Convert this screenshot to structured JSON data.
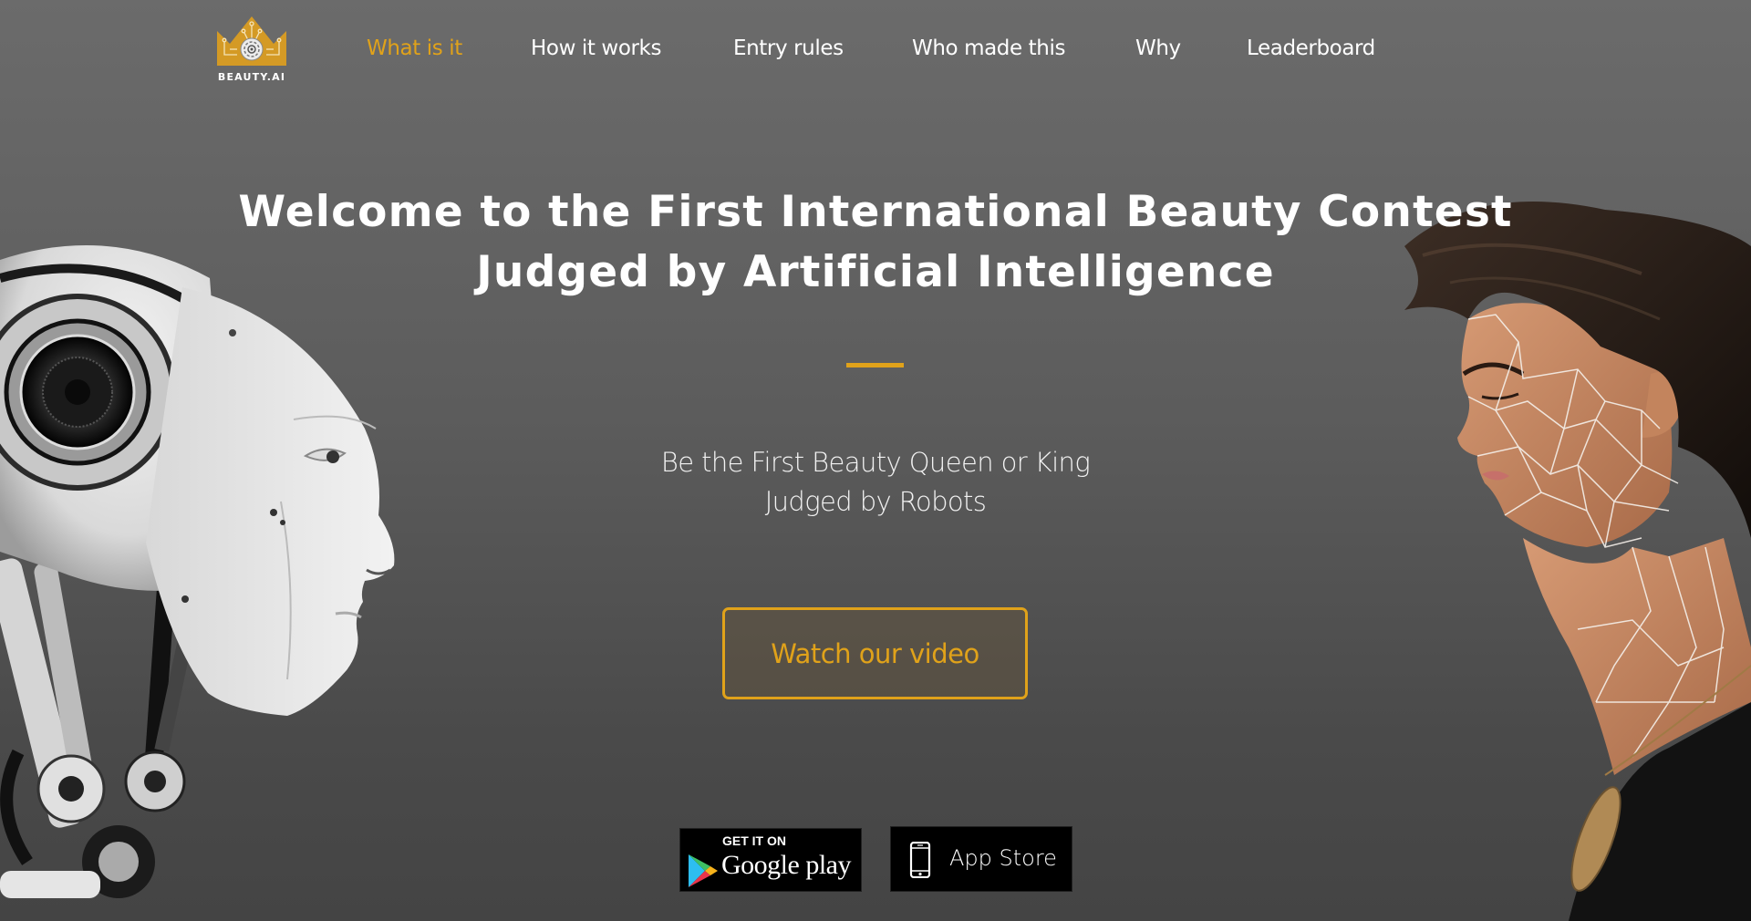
{
  "brand": {
    "name": "BEAUTY.AI",
    "accent_color": "#e0a21a"
  },
  "nav": {
    "items": [
      {
        "label": "What is it",
        "active": true
      },
      {
        "label": "How it works",
        "active": false
      },
      {
        "label": "Entry rules",
        "active": false
      },
      {
        "label": "Who made this",
        "active": false
      },
      {
        "label": "Why",
        "active": false
      },
      {
        "label": "Leaderboard",
        "active": false
      }
    ]
  },
  "hero": {
    "title_line1": "Welcome to the First International Beauty Contest",
    "title_line2": "Judged by Artificial Intelligence",
    "subtitle_line1": "Be the First Beauty Queen or King",
    "subtitle_line2": "Judged by Robots",
    "cta_label": "Watch our video"
  },
  "stores": {
    "google_play": {
      "top_text": "GET IT ON",
      "name": "Google play"
    },
    "app_store": {
      "name": "App Store"
    }
  },
  "images": {
    "left": "robot-head-profile",
    "right": "woman-profile-face-mesh"
  }
}
